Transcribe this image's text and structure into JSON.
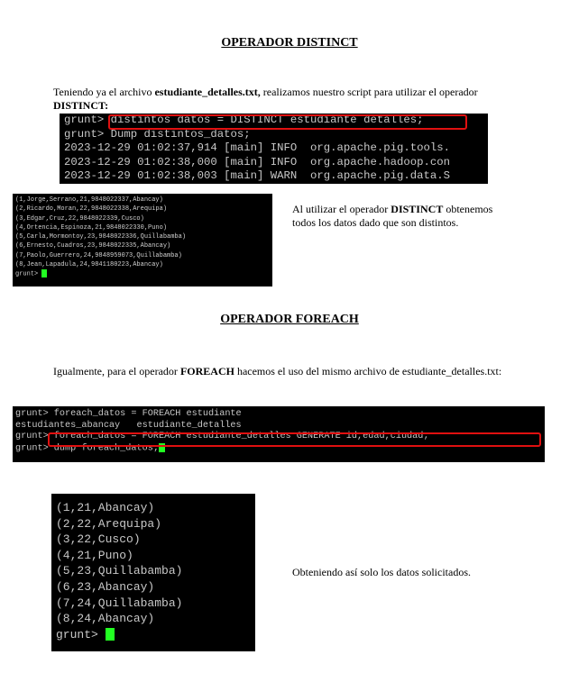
{
  "sections": {
    "distinct": {
      "heading": "OPERADOR DISTINCT",
      "intro_pre": "Teniendo ya el archivo ",
      "intro_file": "estudiante_detalles.txt,",
      "intro_mid": " realizamos nuestro script para utilizar el operador ",
      "intro_op": "DISTINCT:",
      "terminal1": [
        "grunt> distintos datos = DISTINCT estudiante detalles;",
        "grunt> Dump distintos_datos;",
        "2023-12-29 01:02:37,914 [main] INFO  org.apache.pig.tools.",
        "2023-12-29 01:02:38,000 [main] INFO  org.apache.hadoop.con",
        "2023-12-29 01:02:38,003 [main] WARN  org.apache.pig.data.S"
      ],
      "terminal2": [
        "(1,Jorge,Serrano,21,9848022337,Abancay)",
        "(2,Ricardo,Moran,22,9848022338,Arequipa)",
        "(3,Edgar,Cruz,22,9848022339,Cusco)",
        "(4,Ortencia,Espinoza,21,9848022330,Puno)",
        "(5,Carla,Mormontoy,23,9848022336,Quillabamba)",
        "(6,Ernesto,Cuadros,23,9848022335,Abancay)",
        "(7,Paolo,Guerrero,24,9848959073,Quillabamba)",
        "(8,Jean,Lapadula,24,9841180223,Abancay)",
        "grunt> "
      ],
      "note_pre": "Al utilizar el operador ",
      "note_op": "DISTINCT",
      "note_post": " obtenemos todos los datos dado que son distintos."
    },
    "foreach": {
      "heading": "OPERADOR FOREACH",
      "intro_pre": "Igualmente, para el operador ",
      "intro_op": "FOREACH",
      "intro_post": " hacemos el uso del mismo archivo de estudiante_detalles.txt:",
      "terminal1": [
        "grunt> foreach_datos = FOREACH estudiante",
        "estudiantes_abancay   estudiante_detalles",
        "grunt> foreach_datos = FOREACH estudiante_detalles GENERATE id,edad,ciudad;",
        "grunt> dump foreach_datos;"
      ],
      "terminal2": [
        "(1,21,Abancay)",
        "(2,22,Arequipa)",
        "(3,22,Cusco)",
        "(4,21,Puno)",
        "(5,23,Quillabamba)",
        "(6,23,Abancay)",
        "(7,24,Quillabamba)",
        "(8,24,Abancay)",
        "grunt> "
      ],
      "note": "Obteniendo así solo los datos solicitados."
    }
  },
  "colors": {
    "terminal_bg": "#000000",
    "terminal_text": "#c8c8c8",
    "highlight": "#e01010",
    "cursor": "#22ff22"
  }
}
